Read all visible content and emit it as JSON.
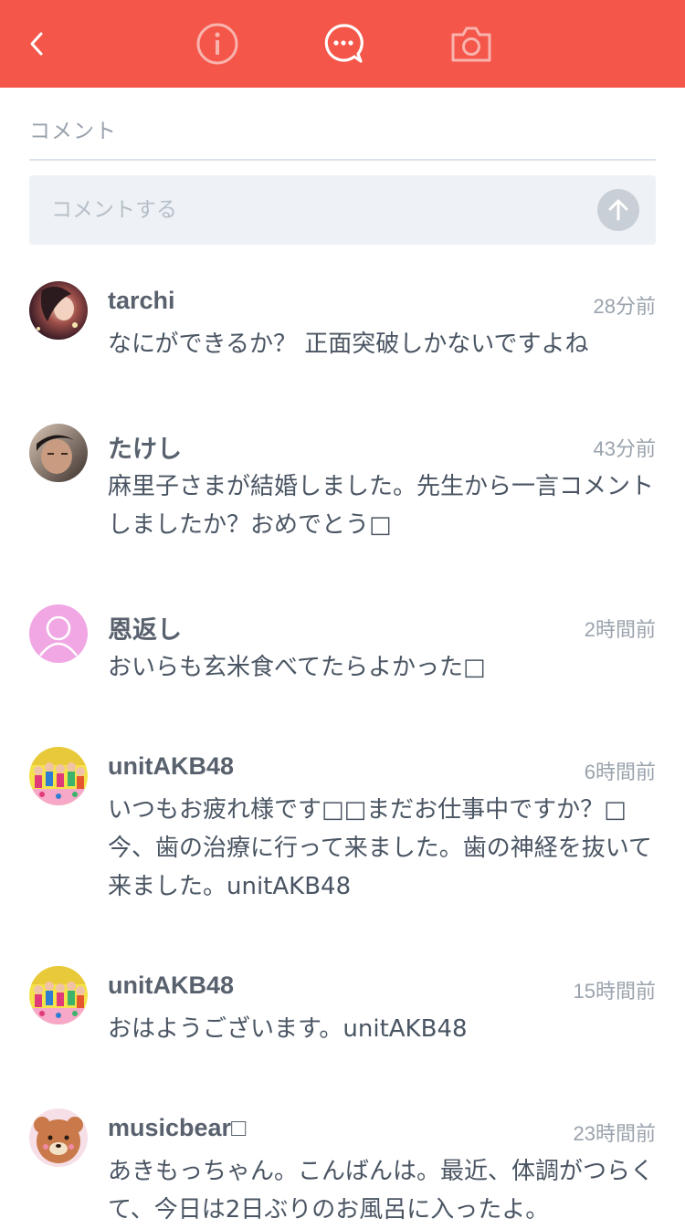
{
  "header": {
    "icons": [
      "chevron-left-icon",
      "info-icon",
      "comment-icon",
      "camera-icon"
    ],
    "active_tab": "comment",
    "accent_color": "#f4564a"
  },
  "comments_section": {
    "label": "コメント",
    "input_placeholder": "コメントする",
    "input_value": ""
  },
  "comments": [
    {
      "user": "tarchi",
      "time": "28分前",
      "text": "なにができるか？ 正面突破しかないですよね",
      "avatar": "photo"
    },
    {
      "user": "たけし",
      "time": "43分前",
      "text": "麻里子さまが結婚しました。先生から一言コメントしましたか？おめでとう□",
      "avatar": "photo"
    },
    {
      "user": "恩返し",
      "time": "2時間前",
      "text": "おいらも玄米食べてたらよかった□",
      "avatar": "default-user"
    },
    {
      "user": "unitAKB48",
      "time": "6時間前",
      "text": "いつもお疲れ様です□□まだお仕事中ですか？□今、歯の治療に行って来ました。歯の神経を抜いて来ました。unitAKB48",
      "avatar": "group-photo"
    },
    {
      "user": "unitAKB48",
      "time": "15時間前",
      "text": "おはようございます。unitAKB48",
      "avatar": "group-photo"
    },
    {
      "user": "musicbear□",
      "time": "23時間前",
      "text": "あきもっちゃん。こんばんは。最近、体調がつらくて、今日は2日ぶりのお風呂に入ったよ。",
      "avatar": "bear"
    }
  ]
}
